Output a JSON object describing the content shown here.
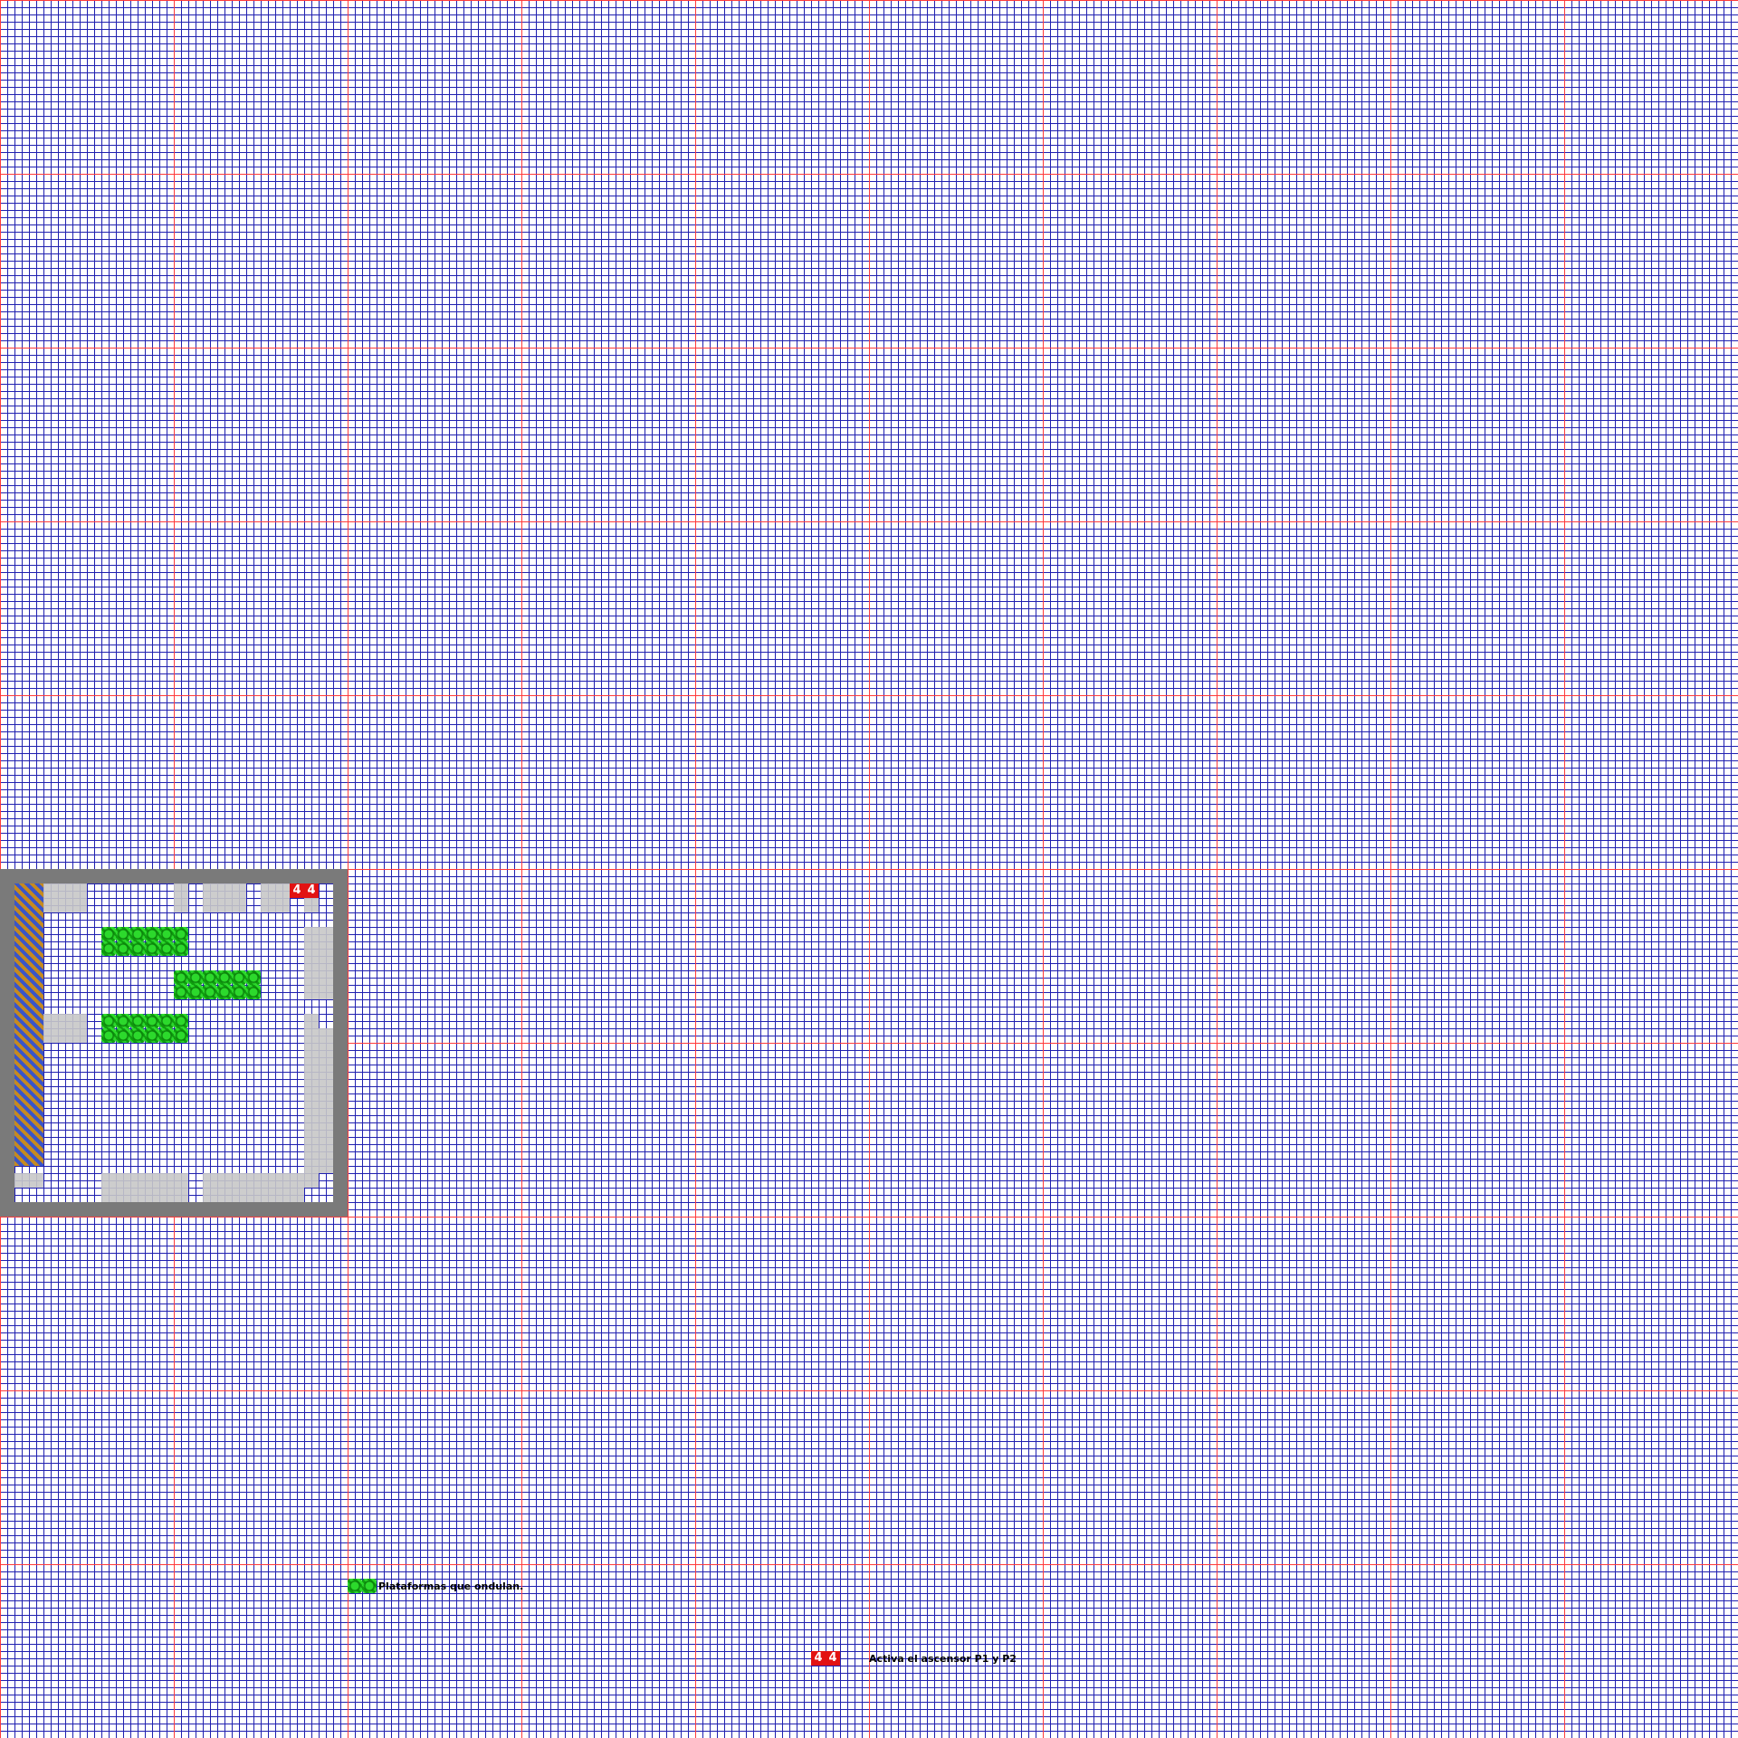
{
  "room": {
    "switch_tiles": [
      "4",
      "4"
    ]
  },
  "legend": {
    "wavy": {
      "icon": "wavy-platform-icon",
      "text": "Plataformas que ondulan."
    },
    "switch": {
      "tiles": [
        "4",
        "4"
      ],
      "text": "Activa el ascensor P1 y P2"
    }
  },
  "colors": {
    "grid_minor": "#2020b0",
    "grid_major": "#ff3b3b",
    "room_border": "#7a7a7a",
    "solid_tile": "#c8c8c8",
    "switch_tile": "#e21212",
    "wavy_platform": "#2cd92c"
  }
}
